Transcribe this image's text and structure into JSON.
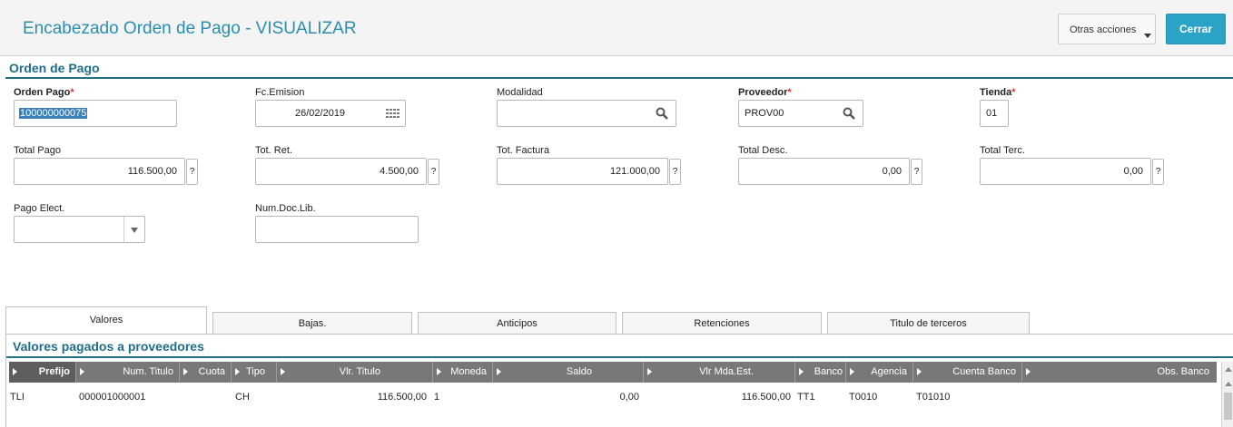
{
  "header": {
    "title": "Encabezado Orden de Pago - VISUALIZAR",
    "more_actions": "Otras acciones",
    "close": "Cerrar"
  },
  "section": {
    "title": "Orden de Pago"
  },
  "fields": {
    "orden_pago": {
      "label": "Orden Pago",
      "value": "100000000075",
      "required": "*"
    },
    "fc_emision": {
      "label": "Fc.Emision",
      "value": "26/02/2019"
    },
    "modalidad": {
      "label": "Modalidad",
      "value": ""
    },
    "proveedor": {
      "label": "Proveedor",
      "value": "PROV00",
      "required": "*"
    },
    "tienda": {
      "label": "Tienda",
      "value": "01",
      "required": "*"
    },
    "total_pago": {
      "label": "Total Pago",
      "value": "116.500,00",
      "help": "?"
    },
    "tot_ret": {
      "label": "Tot. Ret.",
      "value": "4.500,00",
      "help": "?"
    },
    "tot_factura": {
      "label": "Tot. Factura",
      "value": "121.000,00",
      "help": "?"
    },
    "total_desc": {
      "label": "Total Desc.",
      "value": "0,00",
      "help": "?"
    },
    "total_terc": {
      "label": "Total Terc.",
      "value": "0,00",
      "help": "?"
    },
    "pago_elect": {
      "label": "Pago Elect.",
      "value": ""
    },
    "num_doc_lib": {
      "label": "Num.Doc.Lib.",
      "value": ""
    }
  },
  "tabs": [
    {
      "label": "Valores",
      "active": true
    },
    {
      "label": "Bajas."
    },
    {
      "label": "Anticipos"
    },
    {
      "label": "Retenciones"
    },
    {
      "label": "Titulo de terceros"
    }
  ],
  "grid": {
    "title": "Valores pagados a proveedores",
    "columns": [
      "Prefijo",
      "Num. Titulo",
      "Cuota",
      "Tipo",
      "Vlr. Titulo",
      "Moneda",
      "Saldo",
      "Vlr Mda.Est.",
      "Banco",
      "Agencia",
      "Cuenta Banco",
      "Obs. Banco"
    ],
    "rows": [
      [
        "TLI",
        "000001000001",
        "",
        "CH",
        "116.500,00",
        "1",
        "0,00",
        "116.500,00",
        "TT1",
        "T0010",
        "T01010",
        ""
      ]
    ]
  }
}
